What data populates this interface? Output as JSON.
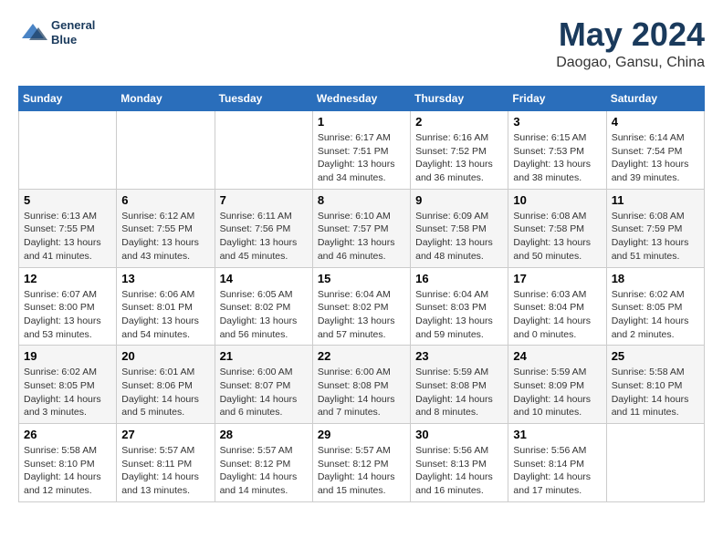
{
  "header": {
    "logo_line1": "General",
    "logo_line2": "Blue",
    "title": "May 2024",
    "location": "Daogao, Gansu, China"
  },
  "weekdays": [
    "Sunday",
    "Monday",
    "Tuesday",
    "Wednesday",
    "Thursday",
    "Friday",
    "Saturday"
  ],
  "weeks": [
    [
      {
        "day": "",
        "info": ""
      },
      {
        "day": "",
        "info": ""
      },
      {
        "day": "",
        "info": ""
      },
      {
        "day": "1",
        "info": "Sunrise: 6:17 AM\nSunset: 7:51 PM\nDaylight: 13 hours\nand 34 minutes."
      },
      {
        "day": "2",
        "info": "Sunrise: 6:16 AM\nSunset: 7:52 PM\nDaylight: 13 hours\nand 36 minutes."
      },
      {
        "day": "3",
        "info": "Sunrise: 6:15 AM\nSunset: 7:53 PM\nDaylight: 13 hours\nand 38 minutes."
      },
      {
        "day": "4",
        "info": "Sunrise: 6:14 AM\nSunset: 7:54 PM\nDaylight: 13 hours\nand 39 minutes."
      }
    ],
    [
      {
        "day": "5",
        "info": "Sunrise: 6:13 AM\nSunset: 7:55 PM\nDaylight: 13 hours\nand 41 minutes."
      },
      {
        "day": "6",
        "info": "Sunrise: 6:12 AM\nSunset: 7:55 PM\nDaylight: 13 hours\nand 43 minutes."
      },
      {
        "day": "7",
        "info": "Sunrise: 6:11 AM\nSunset: 7:56 PM\nDaylight: 13 hours\nand 45 minutes."
      },
      {
        "day": "8",
        "info": "Sunrise: 6:10 AM\nSunset: 7:57 PM\nDaylight: 13 hours\nand 46 minutes."
      },
      {
        "day": "9",
        "info": "Sunrise: 6:09 AM\nSunset: 7:58 PM\nDaylight: 13 hours\nand 48 minutes."
      },
      {
        "day": "10",
        "info": "Sunrise: 6:08 AM\nSunset: 7:58 PM\nDaylight: 13 hours\nand 50 minutes."
      },
      {
        "day": "11",
        "info": "Sunrise: 6:08 AM\nSunset: 7:59 PM\nDaylight: 13 hours\nand 51 minutes."
      }
    ],
    [
      {
        "day": "12",
        "info": "Sunrise: 6:07 AM\nSunset: 8:00 PM\nDaylight: 13 hours\nand 53 minutes."
      },
      {
        "day": "13",
        "info": "Sunrise: 6:06 AM\nSunset: 8:01 PM\nDaylight: 13 hours\nand 54 minutes."
      },
      {
        "day": "14",
        "info": "Sunrise: 6:05 AM\nSunset: 8:02 PM\nDaylight: 13 hours\nand 56 minutes."
      },
      {
        "day": "15",
        "info": "Sunrise: 6:04 AM\nSunset: 8:02 PM\nDaylight: 13 hours\nand 57 minutes."
      },
      {
        "day": "16",
        "info": "Sunrise: 6:04 AM\nSunset: 8:03 PM\nDaylight: 13 hours\nand 59 minutes."
      },
      {
        "day": "17",
        "info": "Sunrise: 6:03 AM\nSunset: 8:04 PM\nDaylight: 14 hours\nand 0 minutes."
      },
      {
        "day": "18",
        "info": "Sunrise: 6:02 AM\nSunset: 8:05 PM\nDaylight: 14 hours\nand 2 minutes."
      }
    ],
    [
      {
        "day": "19",
        "info": "Sunrise: 6:02 AM\nSunset: 8:05 PM\nDaylight: 14 hours\nand 3 minutes."
      },
      {
        "day": "20",
        "info": "Sunrise: 6:01 AM\nSunset: 8:06 PM\nDaylight: 14 hours\nand 5 minutes."
      },
      {
        "day": "21",
        "info": "Sunrise: 6:00 AM\nSunset: 8:07 PM\nDaylight: 14 hours\nand 6 minutes."
      },
      {
        "day": "22",
        "info": "Sunrise: 6:00 AM\nSunset: 8:08 PM\nDaylight: 14 hours\nand 7 minutes."
      },
      {
        "day": "23",
        "info": "Sunrise: 5:59 AM\nSunset: 8:08 PM\nDaylight: 14 hours\nand 8 minutes."
      },
      {
        "day": "24",
        "info": "Sunrise: 5:59 AM\nSunset: 8:09 PM\nDaylight: 14 hours\nand 10 minutes."
      },
      {
        "day": "25",
        "info": "Sunrise: 5:58 AM\nSunset: 8:10 PM\nDaylight: 14 hours\nand 11 minutes."
      }
    ],
    [
      {
        "day": "26",
        "info": "Sunrise: 5:58 AM\nSunset: 8:10 PM\nDaylight: 14 hours\nand 12 minutes."
      },
      {
        "day": "27",
        "info": "Sunrise: 5:57 AM\nSunset: 8:11 PM\nDaylight: 14 hours\nand 13 minutes."
      },
      {
        "day": "28",
        "info": "Sunrise: 5:57 AM\nSunset: 8:12 PM\nDaylight: 14 hours\nand 14 minutes."
      },
      {
        "day": "29",
        "info": "Sunrise: 5:57 AM\nSunset: 8:12 PM\nDaylight: 14 hours\nand 15 minutes."
      },
      {
        "day": "30",
        "info": "Sunrise: 5:56 AM\nSunset: 8:13 PM\nDaylight: 14 hours\nand 16 minutes."
      },
      {
        "day": "31",
        "info": "Sunrise: 5:56 AM\nSunset: 8:14 PM\nDaylight: 14 hours\nand 17 minutes."
      },
      {
        "day": "",
        "info": ""
      }
    ]
  ]
}
